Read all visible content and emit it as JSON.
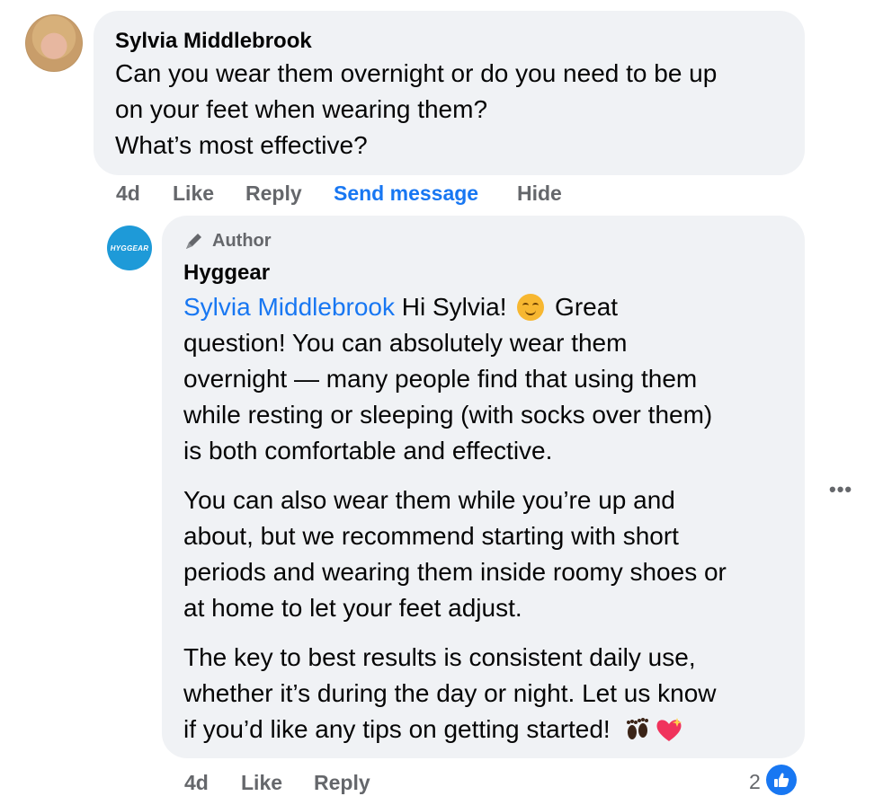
{
  "comment": {
    "author": "Sylvia Middlebrook",
    "lines": [
      "Can you wear them overnight or do you need to be up",
      "on your feet when wearing them?",
      "What’s most effective?"
    ],
    "actions": {
      "time": "4d",
      "like": "Like",
      "reply": "Reply",
      "send_message": "Send message",
      "hide": "Hide"
    }
  },
  "reply": {
    "badge": "Author",
    "author": "Hyggear",
    "avatar_text": "HYGGEAR",
    "mention": "Sylvia Middlebrook",
    "p1": {
      "first_line_a": "Hi Sylvia!",
      "first_line_b": "Great",
      "lines": [
        "question! You can absolutely wear them",
        "overnight — many people find that using them",
        "while resting or sleeping (with socks over them)",
        "is both comfortable and effective."
      ]
    },
    "p2": {
      "lines": [
        "You can also wear them while you’re up and",
        "about, but we recommend starting with short",
        "periods and wearing them inside roomy shoes or",
        "at home to let your feet adjust."
      ]
    },
    "p3": {
      "lines": [
        "The key to best results is consistent daily use,",
        "whether it’s during the day or night. Let us know"
      ],
      "last_line": "if you’d like any tips on getting started!"
    },
    "more": "•••",
    "actions": {
      "time": "4d",
      "like": "Like",
      "reply": "Reply"
    },
    "reaction_count": "2"
  }
}
